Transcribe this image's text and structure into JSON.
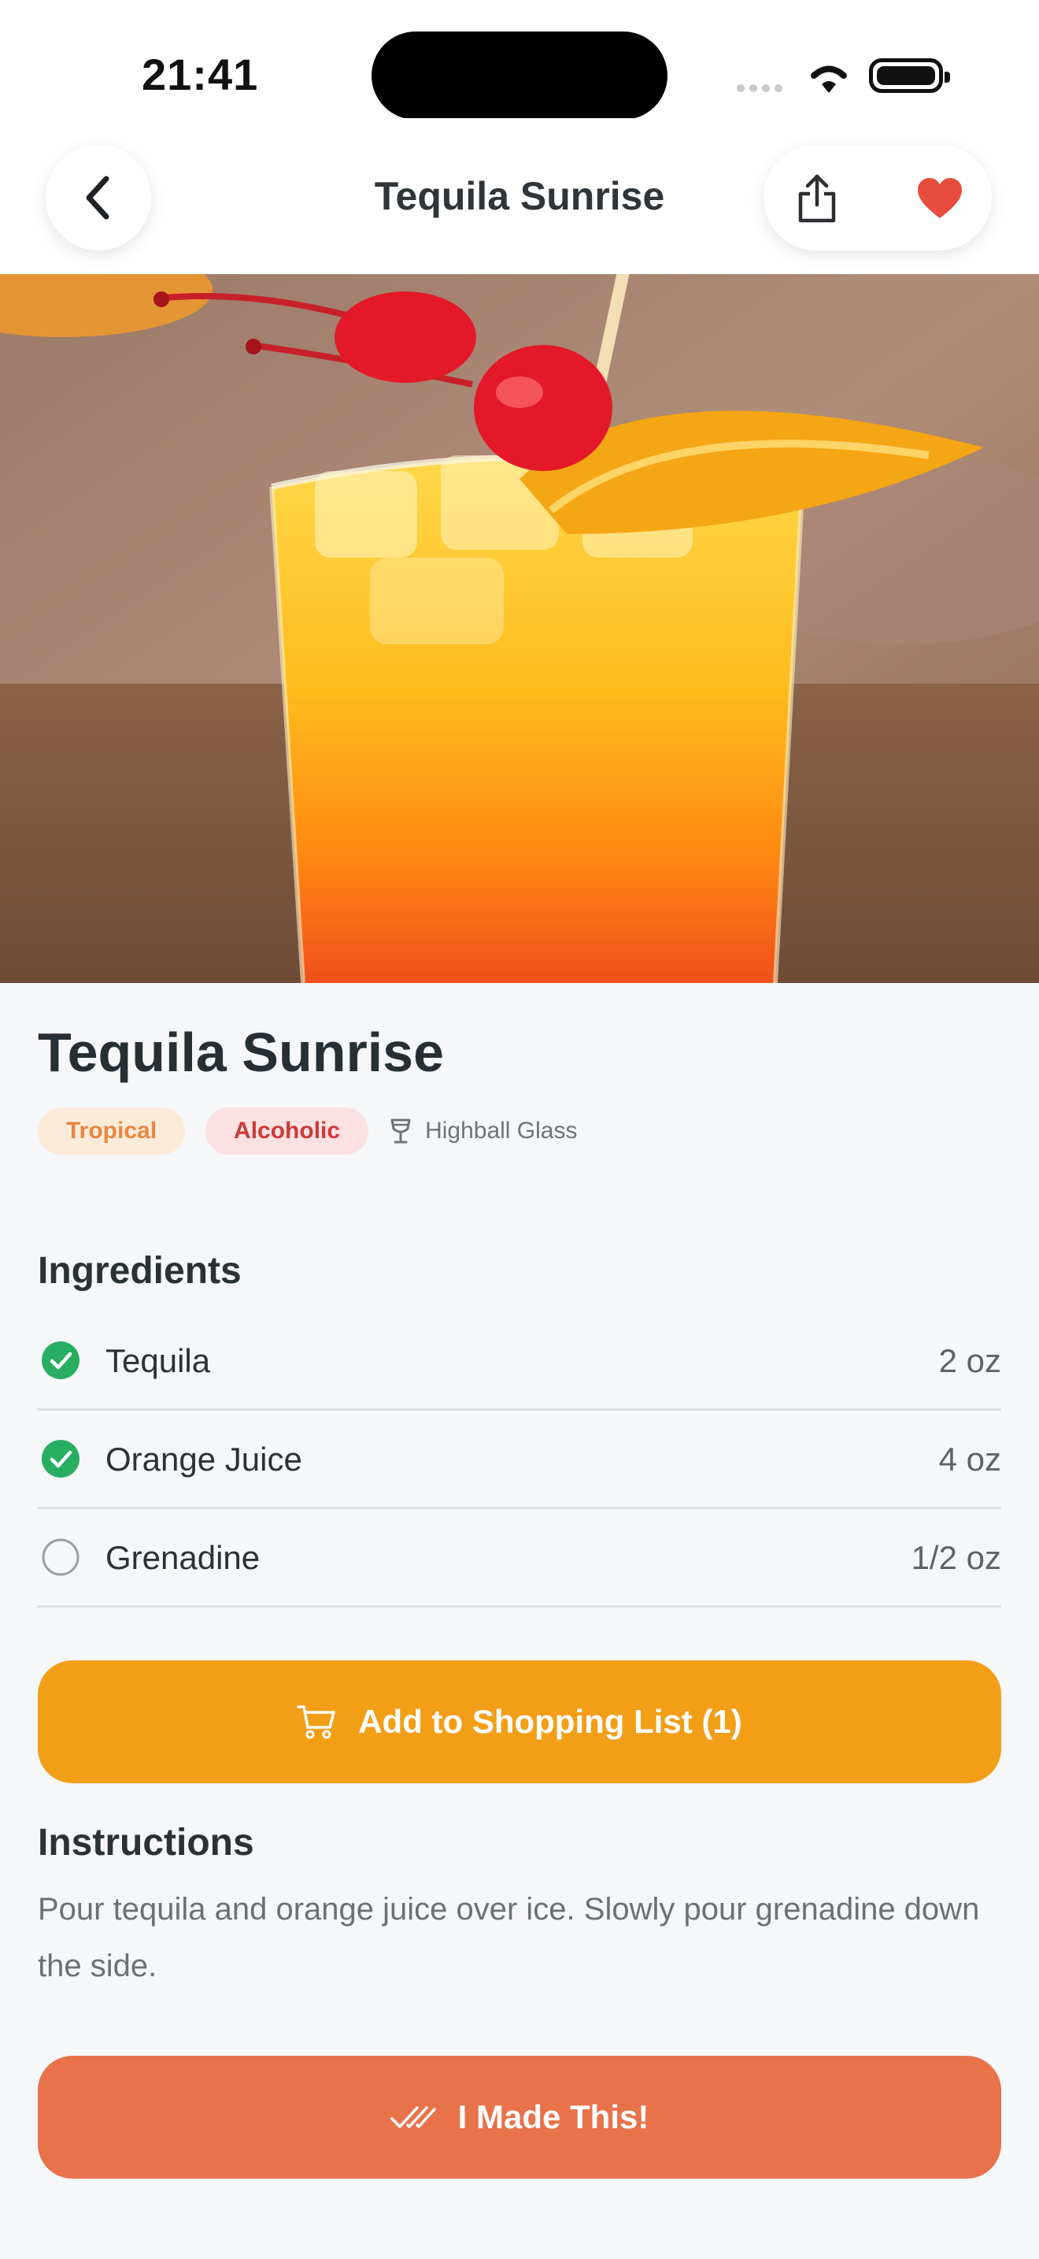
{
  "status_bar": {
    "time": "21:41"
  },
  "nav": {
    "title": "Tequila Sunrise"
  },
  "drink": {
    "name": "Tequila Sunrise",
    "tags": [
      "Tropical",
      "Alcoholic"
    ],
    "glass": "Highball Glass"
  },
  "ingredients": {
    "heading": "Ingredients",
    "items": [
      {
        "name": "Tequila",
        "amount": "2 oz",
        "checked": true
      },
      {
        "name": "Orange Juice",
        "amount": "4 oz",
        "checked": true
      },
      {
        "name": "Grenadine",
        "amount": "1/2 oz",
        "checked": false
      }
    ]
  },
  "shopping_button": {
    "label": "Add to Shopping List (1)"
  },
  "instructions": {
    "heading": "Instructions",
    "text": "Pour tequila and orange juice over ice. Slowly pour grenadine down the side."
  },
  "made_button": {
    "label": "I Made This!"
  },
  "colors": {
    "accent_orange": "#f29e17",
    "made_button": "#e8724a",
    "check_green": "#27ae60",
    "heart_red": "#e74c3c"
  },
  "icons": [
    "chevron-left-icon",
    "share-icon",
    "heart-icon",
    "cocktail-glass-icon",
    "check-circle-icon",
    "empty-circle-icon",
    "cart-icon",
    "double-check-icon"
  ]
}
